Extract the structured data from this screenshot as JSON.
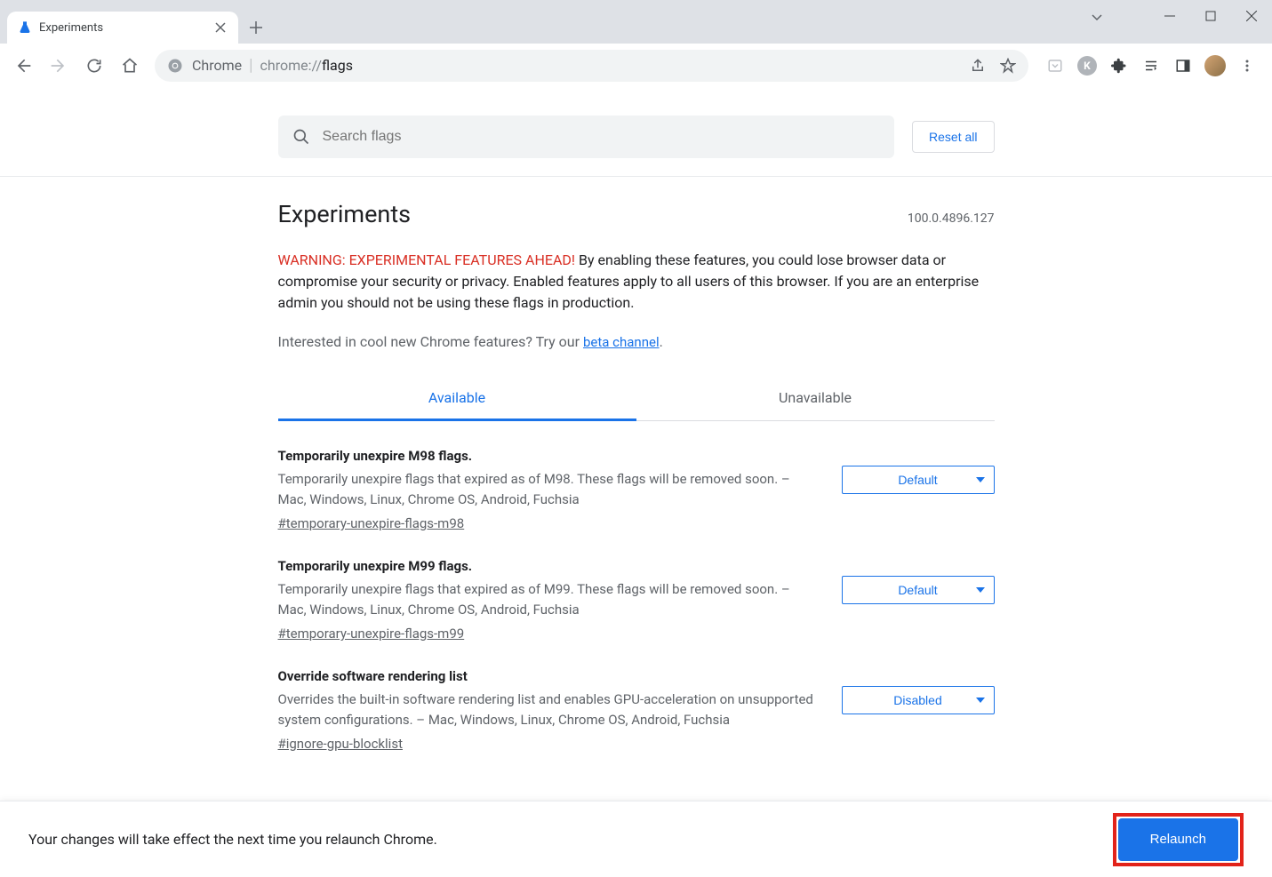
{
  "browser": {
    "tab_title": "Experiments",
    "url_label": "Chrome",
    "url_prefix": "chrome://",
    "url_suffix": "flags"
  },
  "search": {
    "placeholder": "Search flags",
    "reset_label": "Reset all"
  },
  "header": {
    "title": "Experiments",
    "version": "100.0.4896.127",
    "warning_prefix": "WARNING: EXPERIMENTAL FEATURES AHEAD!",
    "warning_body": " By enabling these features, you could lose browser data or compromise your security or privacy. Enabled features apply to all users of this browser. If you are an enterprise admin you should not be using these flags in production.",
    "beta_text": "Interested in cool new Chrome features? Try our ",
    "beta_link": "beta channel",
    "beta_suffix": "."
  },
  "tabs": {
    "available": "Available",
    "unavailable": "Unavailable"
  },
  "flags": [
    {
      "title": "Temporarily unexpire M98 flags.",
      "desc": "Temporarily unexpire flags that expired as of M98. These flags will be removed soon. – Mac, Windows, Linux, Chrome OS, Android, Fuchsia",
      "hash": "#temporary-unexpire-flags-m98",
      "value": "Default"
    },
    {
      "title": "Temporarily unexpire M99 flags.",
      "desc": "Temporarily unexpire flags that expired as of M99. These flags will be removed soon. – Mac, Windows, Linux, Chrome OS, Android, Fuchsia",
      "hash": "#temporary-unexpire-flags-m99",
      "value": "Default"
    },
    {
      "title": "Override software rendering list",
      "desc": "Overrides the built-in software rendering list and enables GPU-acceleration on unsupported system configurations. – Mac, Windows, Linux, Chrome OS, Android, Fuchsia",
      "hash": "#ignore-gpu-blocklist",
      "value": "Disabled"
    }
  ],
  "footer": {
    "text": "Your changes will take effect the next time you relaunch Chrome.",
    "button": "Relaunch"
  }
}
